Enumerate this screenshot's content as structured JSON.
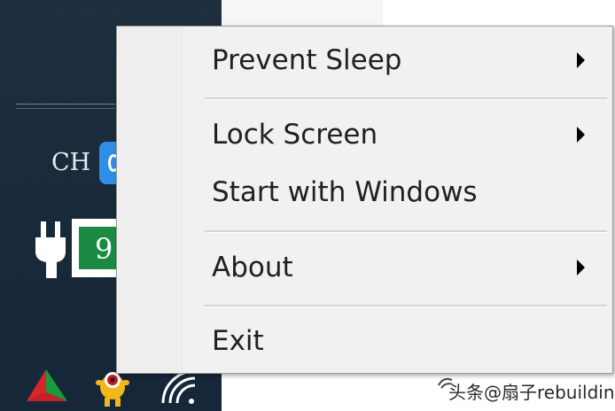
{
  "taskbar": {
    "language": "CH",
    "battery_level": "9"
  },
  "context_menu": {
    "items": [
      {
        "label": "Prevent Sleep",
        "has_submenu": true
      },
      {
        "label": "Lock Screen",
        "has_submenu": true
      },
      {
        "label": "Start with Windows",
        "has_submenu": false
      },
      {
        "label": "About",
        "has_submenu": true
      },
      {
        "label": "Exit",
        "has_submenu": false
      }
    ]
  },
  "watermark": {
    "text": "头条@扇子rebuilding"
  },
  "colors": {
    "taskbar_bg": "#1e2f3e",
    "menu_bg": "#f1f1f1",
    "battery_green": "#1b8b43",
    "tile_blue": "#2f8fe6"
  },
  "icons": [
    "power-plug-icon",
    "battery-icon",
    "app-tile-icon",
    "color-triangle-icon",
    "monster-icon",
    "wifi-icon",
    "chevron-right-icon"
  ]
}
